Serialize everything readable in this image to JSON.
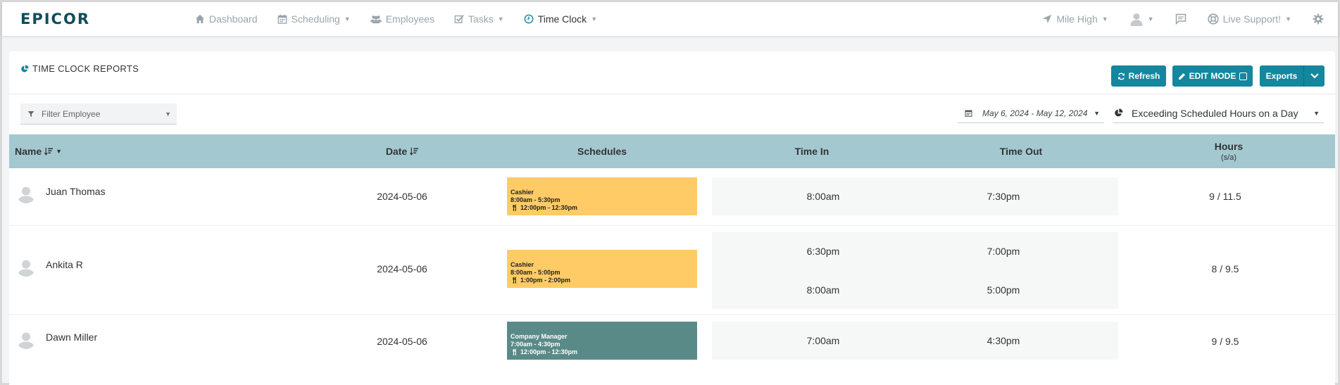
{
  "brand": {
    "logo": "EPICOR",
    "accent": "#14879e",
    "header_bg": "#a3c8d0"
  },
  "nav": {
    "items": [
      {
        "label": "Dashboard",
        "icon": "home-icon",
        "caret": false,
        "active": false
      },
      {
        "label": "Scheduling",
        "icon": "calendar-icon",
        "caret": true,
        "active": false
      },
      {
        "label": "Employees",
        "icon": "users-icon",
        "caret": false,
        "active": false
      },
      {
        "label": "Tasks",
        "icon": "checkbox-icon",
        "caret": true,
        "active": false
      },
      {
        "label": "Time Clock",
        "icon": "clock-icon",
        "caret": true,
        "active": true
      }
    ],
    "right": {
      "location": "Mile High",
      "support": "Live Support!"
    }
  },
  "panel": {
    "title": "TIME CLOCK REPORTS",
    "refresh_label": "Refresh",
    "edit_label": "EDIT MODE",
    "exports_label": "Exports"
  },
  "filters": {
    "employee_placeholder": "Filter Employee",
    "date_range": "May 6, 2024 - May 12, 2024",
    "report": "Exceeding Scheduled Hours on a Day"
  },
  "table": {
    "headers": {
      "name": "Name",
      "date": "Date",
      "schedules": "Schedules",
      "time_in": "Time In",
      "time_out": "Time Out",
      "hours": "Hours",
      "hours_sub": "(s/a)"
    },
    "rows": [
      {
        "name": "Juan Thomas",
        "date": "2024-05-06",
        "schedule": {
          "role": "Cashier",
          "time": "8:00am - 5:30pm",
          "break": "12:00pm - 12:30pm",
          "color": "#fecb66"
        },
        "punches": [
          {
            "in": "8:00am",
            "out": "7:30pm"
          }
        ],
        "hours": "9 / 11.5"
      },
      {
        "name": "Ankita R",
        "date": "2024-05-06",
        "schedule": {
          "role": "Cashier",
          "time": "8:00am - 5:00pm",
          "break": "1:00pm - 2:00pm",
          "color": "#fecb66"
        },
        "punches": [
          {
            "in": "6:30pm",
            "out": "7:00pm"
          },
          {
            "in": "8:00am",
            "out": "5:00pm"
          }
        ],
        "hours": "8 / 9.5"
      },
      {
        "name": "Dawn Miller",
        "date": "2024-05-06",
        "schedule": {
          "role": "Company Manager",
          "time": "7:00am - 4:30pm",
          "break": "12:00pm - 12:30pm",
          "color": "#5a8a88"
        },
        "punches": [
          {
            "in": "7:00am",
            "out": "4:30pm"
          }
        ],
        "hours": "9 / 9.5"
      }
    ]
  }
}
